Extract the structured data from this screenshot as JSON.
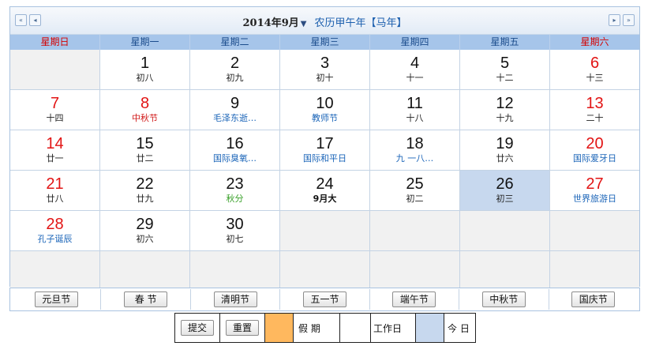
{
  "header": {
    "prev_year_icon": "«",
    "prev_month_icon": "◂",
    "next_month_icon": "▸",
    "next_year_icon": "»",
    "year_month": "2014年9月",
    "dropdown_icon": "▼",
    "lunar_year": "农历甲午年【马年】"
  },
  "weekdays": [
    "星期日",
    "星期一",
    "星期二",
    "星期三",
    "星期四",
    "星期五",
    "星期六"
  ],
  "weeks": [
    [
      {
        "day": "",
        "sub": ""
      },
      {
        "day": "1",
        "sub": "初八"
      },
      {
        "day": "2",
        "sub": "初九"
      },
      {
        "day": "3",
        "sub": "初十"
      },
      {
        "day": "4",
        "sub": "十一"
      },
      {
        "day": "5",
        "sub": "十二"
      },
      {
        "day": "6",
        "sub": "十三"
      }
    ],
    [
      {
        "day": "7",
        "sub": "十四"
      },
      {
        "day": "8",
        "sub": "中秋节"
      },
      {
        "day": "9",
        "sub": "毛泽东逝…"
      },
      {
        "day": "10",
        "sub": "教师节"
      },
      {
        "day": "11",
        "sub": "十八"
      },
      {
        "day": "12",
        "sub": "十九"
      },
      {
        "day": "13",
        "sub": "二十"
      }
    ],
    [
      {
        "day": "14",
        "sub": "廿一"
      },
      {
        "day": "15",
        "sub": "廿二"
      },
      {
        "day": "16",
        "sub": "国际臭氧…"
      },
      {
        "day": "17",
        "sub": "国际和平日"
      },
      {
        "day": "18",
        "sub": "九 一八…"
      },
      {
        "day": "19",
        "sub": "廿六"
      },
      {
        "day": "20",
        "sub": "国际爱牙日"
      }
    ],
    [
      {
        "day": "21",
        "sub": "廿八"
      },
      {
        "day": "22",
        "sub": "廿九"
      },
      {
        "day": "23",
        "sub": "秋分"
      },
      {
        "day": "24",
        "sub": "9月大"
      },
      {
        "day": "25",
        "sub": "初二"
      },
      {
        "day": "26",
        "sub": "初三"
      },
      {
        "day": "27",
        "sub": "世界旅游日"
      }
    ],
    [
      {
        "day": "28",
        "sub": "孔子诞辰"
      },
      {
        "day": "29",
        "sub": "初六"
      },
      {
        "day": "30",
        "sub": "初七"
      },
      {
        "day": "",
        "sub": ""
      },
      {
        "day": "",
        "sub": ""
      },
      {
        "day": "",
        "sub": ""
      },
      {
        "day": "",
        "sub": ""
      }
    ],
    [
      {
        "day": "",
        "sub": ""
      },
      {
        "day": "",
        "sub": ""
      },
      {
        "day": "",
        "sub": ""
      },
      {
        "day": "",
        "sub": ""
      },
      {
        "day": "",
        "sub": ""
      },
      {
        "day": "",
        "sub": ""
      },
      {
        "day": "",
        "sub": ""
      }
    ]
  ],
  "holiday_buttons": [
    "元旦节",
    "春 节",
    "清明节",
    "五一节",
    "端午节",
    "中秋节",
    "国庆节"
  ],
  "legend": {
    "submit": "提交",
    "reset": "重置",
    "holiday_label": "假 期",
    "workday_label": "工作日",
    "today_label": "今 日"
  },
  "colors": {
    "holiday_swatch": "#ffb85e",
    "workday_swatch": "#ffffff",
    "today_swatch": "#c7d8ee",
    "weekday_header_bg": "#a6c5ea",
    "weekend_red": "#e21414",
    "festival_blue": "#1a64b8",
    "solar_term_green": "#3aa12a"
  }
}
